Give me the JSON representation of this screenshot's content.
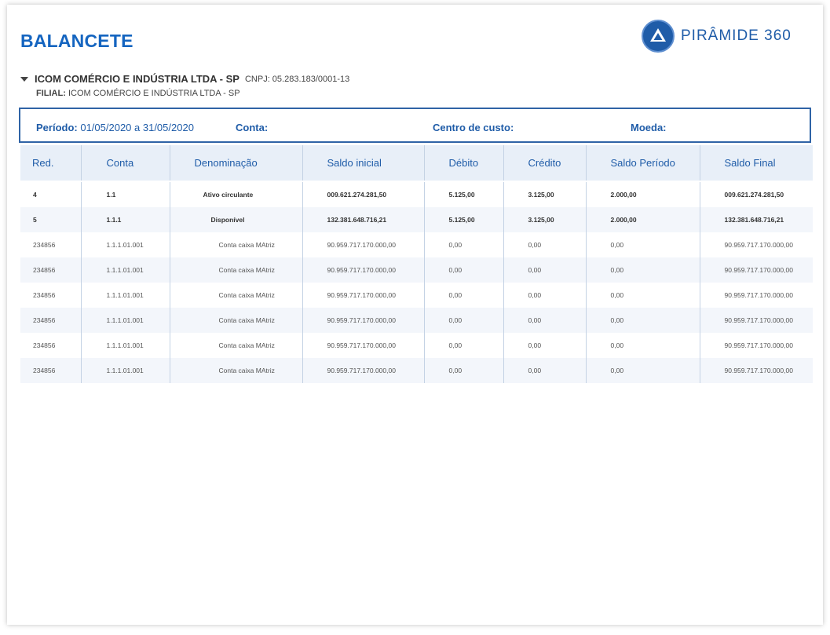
{
  "report": {
    "title": "BALANCETE",
    "logo_text": "PIRÂMIDE 360",
    "company": {
      "name": "ICOM COMÉRCIO E INDÚSTRIA LTDA - SP",
      "cnpj": "CNPJ: 05.283.183/0001-13"
    },
    "filial": {
      "label": "FILIAL:",
      "value": " ICOM COMÉRCIO E INDÚSTRIA LTDA - SP"
    }
  },
  "filters": {
    "periodo_label": "Período:",
    "periodo_value": " 01/05/2020 a 31/05/2020",
    "conta_label": "Conta:",
    "centro_label": "Centro de custo:",
    "moeda_label": "Moeda:"
  },
  "table": {
    "headers": [
      "Red.",
      "Conta",
      "Denominação",
      "Saldo inicial",
      "Débito",
      "Crédito",
      "Saldo Período",
      "Saldo Final"
    ],
    "rows": [
      [
        "4",
        "1.1",
        "Ativo circulante",
        "009.621.274.281,50",
        "5.125,00",
        "3.125,00",
        "2.000,00",
        "009.621.274.281,50"
      ],
      [
        "5",
        "1.1.1",
        "Disponível",
        "132.381.648.716,21",
        "5.125,00",
        "3.125,00",
        "2.000,00",
        "132.381.648.716,21"
      ],
      [
        "234856",
        "1.1.1.01.001",
        "Conta caixa MAtriz",
        "90.959.717.170.000,00",
        "0,00",
        "0,00",
        "0,00",
        "90.959.717.170.000,00"
      ],
      [
        "234856",
        "1.1.1.01.001",
        "Conta caixa MAtriz",
        "90.959.717.170.000,00",
        "0,00",
        "0,00",
        "0,00",
        "90.959.717.170.000,00"
      ],
      [
        "234856",
        "1.1.1.01.001",
        "Conta caixa MAtriz",
        "90.959.717.170.000,00",
        "0,00",
        "0,00",
        "0,00",
        "90.959.717.170.000,00"
      ],
      [
        "234856",
        "1.1.1.01.001",
        "Conta caixa MAtriz",
        "90.959.717.170.000,00",
        "0,00",
        "0,00",
        "0,00",
        "90.959.717.170.000,00"
      ],
      [
        "234856",
        "1.1.1.01.001",
        "Conta caixa MAtriz",
        "90.959.717.170.000,00",
        "0,00",
        "0,00",
        "0,00",
        "90.959.717.170.000,00"
      ],
      [
        "234856",
        "1.1.1.01.001",
        "Conta caixa MAtriz",
        "90.959.717.170.000,00",
        "0,00",
        "0,00",
        "0,00",
        "90.959.717.170.000,00"
      ]
    ]
  },
  "colors": {
    "accent": "#1565c0",
    "header_bg": "#e8eff8",
    "border": "#2f63a6"
  },
  "icons": {
    "logo": "pyramid-logo-icon",
    "expand": "caret-down-icon"
  }
}
